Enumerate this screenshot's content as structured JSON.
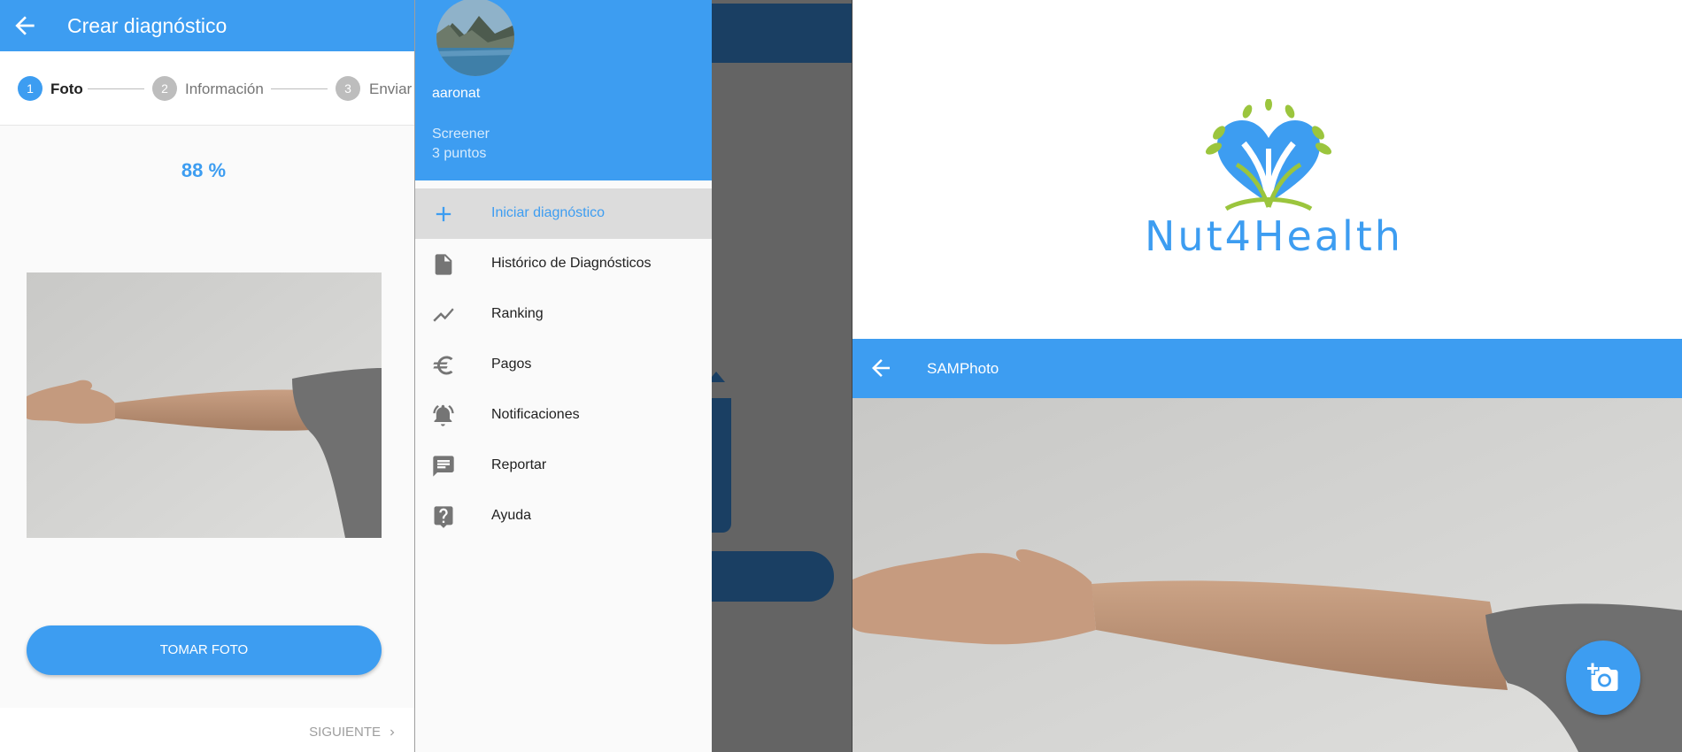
{
  "screen1": {
    "title": "Crear diagnóstico",
    "steps": [
      {
        "number": "1",
        "label": "Foto",
        "active": true
      },
      {
        "number": "2",
        "label": "Información",
        "active": false
      },
      {
        "number": "3",
        "label": "Enviar",
        "active": false
      }
    ],
    "quality_percent": "88 %",
    "take_photo_label": "TOMAR FOTO",
    "next_label": "SIGUIENTE"
  },
  "screen2": {
    "user": {
      "name": "aaronat",
      "role": "Screener",
      "points": "3 puntos"
    },
    "menu": [
      {
        "label": "Iniciar diagnóstico",
        "icon": "plus-icon",
        "active": true
      },
      {
        "label": "Histórico de Diagnósticos",
        "icon": "document-icon",
        "active": false
      },
      {
        "label": "Ranking",
        "icon": "trending-icon",
        "active": false
      },
      {
        "label": "Pagos",
        "icon": "euro-icon",
        "active": false
      },
      {
        "label": "Notificaciones",
        "icon": "bell-icon",
        "active": false
      },
      {
        "label": "Reportar",
        "icon": "comment-icon",
        "active": false
      },
      {
        "label": "Ayuda",
        "icon": "help-icon",
        "active": false
      }
    ]
  },
  "screen3": {
    "brand": "Nut4Health",
    "title": "SAMPhoto"
  },
  "colors": {
    "primary": "#3d9df1",
    "scrim_dark_blue": "#1a3f63",
    "logo_green": "#9bc53d"
  }
}
